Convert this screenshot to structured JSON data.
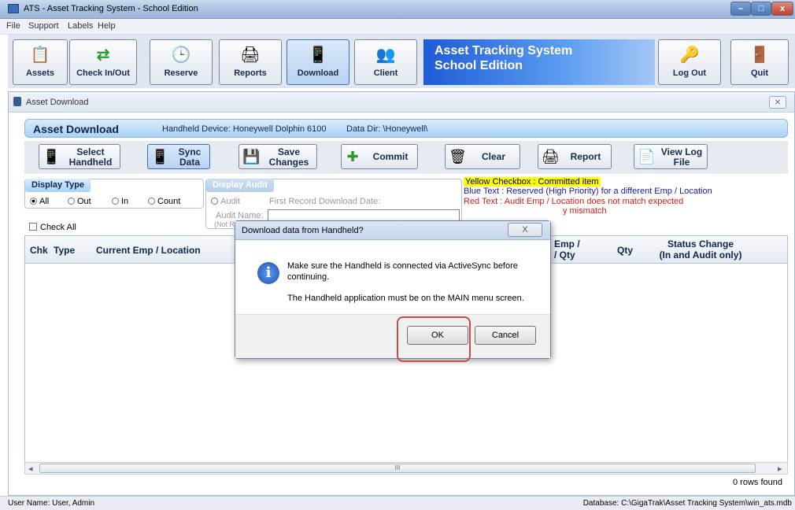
{
  "window": {
    "title": "ATS - Asset Tracking System - School Edition",
    "min": "–",
    "max": "□",
    "close": "x"
  },
  "menu": [
    "File",
    "Support",
    "Labels",
    "Help"
  ],
  "toolbar": {
    "buttons": [
      {
        "label": "Assets",
        "icon": "📋"
      },
      {
        "label": "Check In/Out",
        "icon": "⇄"
      },
      {
        "label": "Reserve",
        "icon": "🕒"
      },
      {
        "label": "Reports",
        "icon": "🖨"
      },
      {
        "label": "Download",
        "icon": "📱"
      },
      {
        "label": "Client",
        "icon": "👥"
      },
      {
        "label": "Log Out",
        "icon": "🔑"
      },
      {
        "label": "Quit",
        "icon": "🚪"
      }
    ],
    "banner_line1": "Asset Tracking System",
    "banner_line2": "School Edition"
  },
  "inner": {
    "title": "Asset Download",
    "close": "⨯",
    "header_title": "Asset Download",
    "device": "Handheld Device:  Honeywell Dolphin 6100",
    "datadir": "Data Dir:  \\Honeywell\\"
  },
  "commands": {
    "select_handheld_1": "Select",
    "select_handheld_2": "Handheld",
    "sync_1": "Sync",
    "sync_2": "Data",
    "save_1": "Save",
    "save_2": "Changes",
    "commit": "Commit",
    "clear": "Clear",
    "report": "Report",
    "viewlog_1": "View Log",
    "viewlog_2": "File"
  },
  "display_type": {
    "title": "Display Type",
    "options": [
      "All",
      "Out",
      "In",
      "Count"
    ],
    "selected": "All",
    "check_all": "Check All"
  },
  "display_audit": {
    "title": "Display Audit",
    "audit_label": "Audit",
    "first_record": "First Record Download Date:",
    "audit_name": "Audit Name:",
    "note": "(Not R"
  },
  "legend": {
    "yellow": "Yellow Checkbox :  Committed item",
    "blue": "Blue Text :  Reserved (High Priority) for a different Emp / Location",
    "red": "Red Text :  Audit Emp / Location does not match expected",
    "mismatch": "y mismatch"
  },
  "grid": {
    "columns": {
      "chk": "Chk",
      "type": "Type",
      "current": "Current Emp / Location",
      "emp": "Emp /",
      "emp2": "/ Qty",
      "qty": "Qty",
      "status1": "Status Change",
      "status2": "(In and Audit only)"
    },
    "rows_found": "0 rows found"
  },
  "scroll": {
    "left": "◂",
    "mid": "III",
    "right": "▸"
  },
  "status": {
    "user": "User Name:  User, Admin",
    "database": "Database:  C:\\GigaTrak\\Asset Tracking System\\win_ats.mdb"
  },
  "dialog": {
    "title": "Download data from Handheld?",
    "close": "X",
    "message1": "Make sure the Handheld is connected via ActiveSync before continuing.",
    "message2": "The Handheld application must be on the MAIN menu screen.",
    "ok": "OK",
    "cancel": "Cancel",
    "icon": "i"
  },
  "colors": {
    "accent": "#1e5bd6",
    "legend_yellow": "#ffff00",
    "legend_blue": "#1a1aa6",
    "legend_red": "#d61a1a",
    "highlight": "#c0504d"
  }
}
